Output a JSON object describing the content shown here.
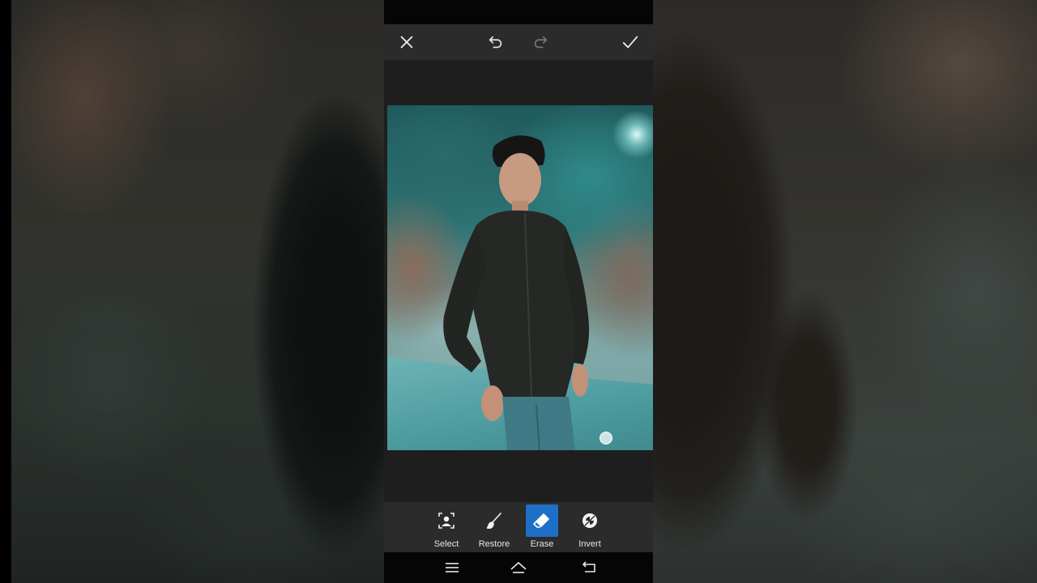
{
  "toolbar": {
    "close_icon": "close-icon",
    "undo_icon": "undo-icon",
    "redo_icon": "redo-icon",
    "apply_icon": "check-icon"
  },
  "tools": {
    "items": [
      {
        "label": "Select",
        "icon": "person-select-icon",
        "active": false
      },
      {
        "label": "Restore",
        "icon": "brush-icon",
        "active": false
      },
      {
        "label": "Erase",
        "icon": "eraser-icon",
        "active": true
      },
      {
        "label": "Invert",
        "icon": "invert-icon",
        "active": false
      }
    ]
  },
  "navbar": {
    "menu_icon": "menu-icon",
    "home_icon": "home-icon",
    "back_icon": "back-icon"
  },
  "colors": {
    "accent": "#1e6fc6",
    "toolbar_bg": "#2b2b2b",
    "canvas_bg": "#1e1e1e",
    "system_bar_bg": "#050505"
  }
}
